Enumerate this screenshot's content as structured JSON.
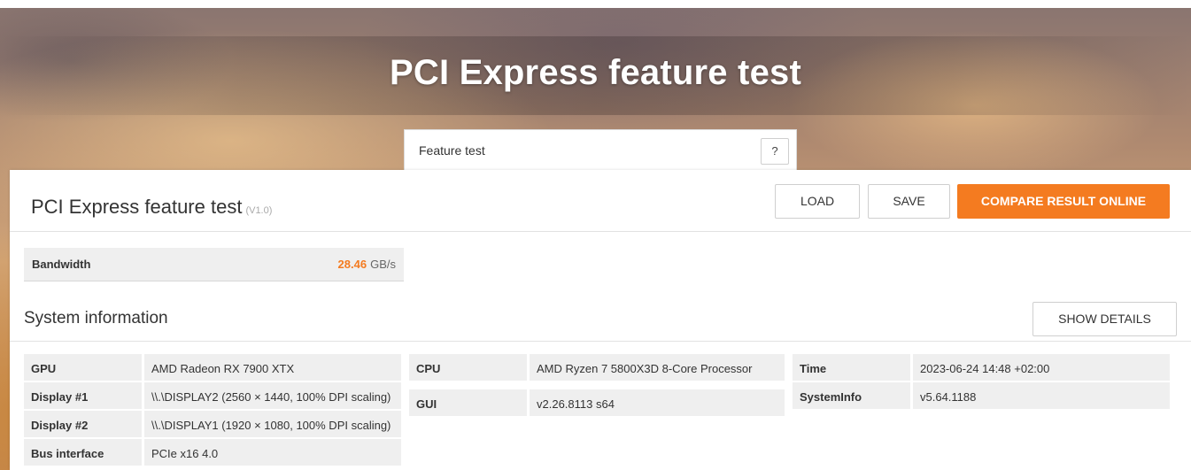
{
  "hero": {
    "title": "PCI Express feature test"
  },
  "tab": {
    "label": "Feature test",
    "help": "?"
  },
  "panel": {
    "title": "PCI Express feature test",
    "version": "(V1.0)",
    "load_label": "LOAD",
    "save_label": "SAVE",
    "compare_label": "COMPARE RESULT ONLINE",
    "compare_color": "#f47b20"
  },
  "result": {
    "label": "Bandwidth",
    "value": "28.46",
    "unit": "GB/s"
  },
  "system": {
    "title": "System information",
    "details_label": "SHOW DETAILS",
    "col1": [
      {
        "key": "GPU",
        "value": "AMD Radeon RX 7900 XTX"
      },
      {
        "key": "Display #1",
        "value": "\\\\.\\DISPLAY2 (2560 × 1440, 100% DPI scaling)"
      },
      {
        "key": "Display #2",
        "value": "\\\\.\\DISPLAY1 (1920 × 1080, 100% DPI scaling)"
      },
      {
        "key": "Bus interface",
        "value": "PCIe x16 4.0"
      }
    ],
    "col2": [
      {
        "key": "CPU",
        "value": "AMD Ryzen 7 5800X3D 8-Core Processor"
      },
      {
        "key": "GUI",
        "value": "v2.26.8113 s64"
      }
    ],
    "col3": [
      {
        "key": "Time",
        "value": "2023-06-24 14:48 +02:00"
      },
      {
        "key": "SystemInfo",
        "value": "v5.64.1188"
      }
    ]
  }
}
